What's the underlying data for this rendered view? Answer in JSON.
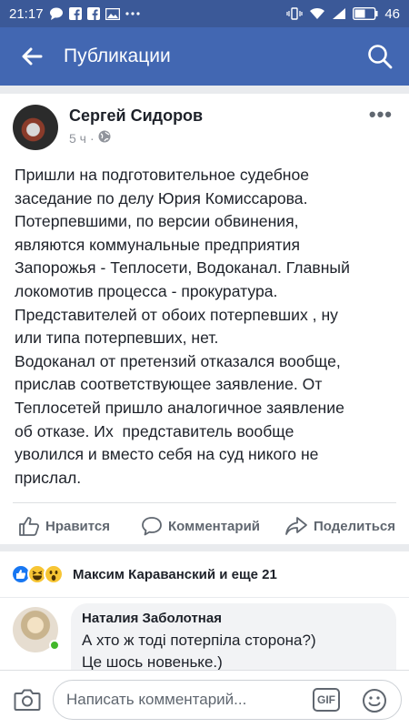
{
  "status_bar": {
    "time": "21:17",
    "battery": "46",
    "icons": [
      "chat-bubble-icon",
      "facebook-icon",
      "facebook-icon",
      "image-icon",
      "more-dots-icon",
      "vibrate-icon",
      "wifi-icon",
      "signal-icon",
      "battery-icon"
    ]
  },
  "app_bar": {
    "title": "Публикации"
  },
  "post": {
    "author": "Сергей Сидоров",
    "time": "5 ч",
    "more": "•••",
    "text": "Пришли на подготовительное судебное\nзаседание по делу Юрия Комиссарова.\nПотерпевшими, по версии обвинения,\nявляются коммунальные предприятия\nЗапорожья - Теплосети, Водоканал. Главный\nлокомотив процесса - прокуратура.\nПредставителей от обоих потерпевших , ну\nили типа потерпевших, нет.\nВодоканал от претензий отказался вообще,\nприслав соответствующее заявление. От\nТеплосетей пришло аналогичное заявление\nоб отказе. Их  представитель вообще\nуволился и вместо себя на суд никого не\nприслал.",
    "actions": {
      "like": "Нравится",
      "comment": "Комментарий",
      "share": "Поделиться"
    }
  },
  "reactions": {
    "text": "Максим Караванский и еще 21",
    "icons": [
      "like-reaction-icon",
      "haha-reaction-icon",
      "wow-reaction-icon"
    ]
  },
  "comment": {
    "author": "Наталия Заболотная",
    "text": "А хто ж тоді потерпіла сторона?)\nЦе шось новеньке.)"
  },
  "compose": {
    "placeholder": "Написать комментарий...",
    "gif_label": "GIF"
  },
  "colors": {
    "status_bar": "#3b5998",
    "app_bar": "#4267b2",
    "like_blue": "#1877f2",
    "online_green": "#42b72a"
  }
}
